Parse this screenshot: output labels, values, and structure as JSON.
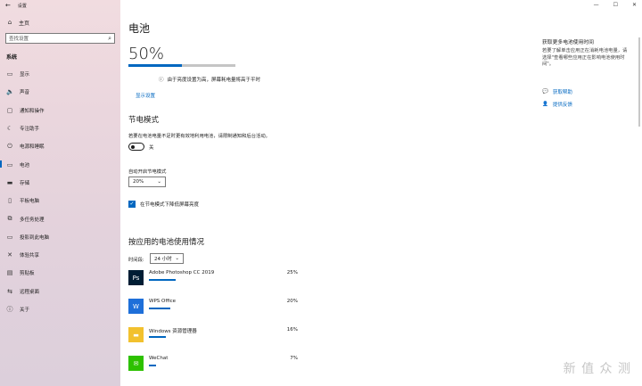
{
  "sidebar": {
    "window_title": "设置",
    "home_label": "主页",
    "search_placeholder": "查找设置",
    "section": "系统",
    "items": [
      {
        "label": "显示",
        "icon": "display-icon"
      },
      {
        "label": "声音",
        "icon": "sound-icon"
      },
      {
        "label": "通知和操作",
        "icon": "notification-icon"
      },
      {
        "label": "专注助手",
        "icon": "focus-assist-icon"
      },
      {
        "label": "电源和睡眠",
        "icon": "power-icon"
      },
      {
        "label": "电池",
        "icon": "battery-icon",
        "active": true
      },
      {
        "label": "存储",
        "icon": "storage-icon"
      },
      {
        "label": "平板电脑",
        "icon": "tablet-icon"
      },
      {
        "label": "多任务处理",
        "icon": "multitasking-icon"
      },
      {
        "label": "投影到此电脑",
        "icon": "projecting-icon"
      },
      {
        "label": "体验共享",
        "icon": "shared-experiences-icon"
      },
      {
        "label": "剪贴板",
        "icon": "clipboard-icon"
      },
      {
        "label": "远程桌面",
        "icon": "remote-desktop-icon"
      },
      {
        "label": "关于",
        "icon": "info-icon"
      }
    ]
  },
  "main": {
    "title": "电池",
    "battery_percent": "50%",
    "battery_level": 0.5,
    "info_text": "由于亮度设置为高，屏幕耗电量将高于平时",
    "show_settings": "显示设置",
    "battery_saver": {
      "heading": "节电模式",
      "description": "若要在电池电量不足时更有效地利用电池，请限制通知和后台活动。",
      "toggle_state": "关",
      "auto_label": "自动开启节电模式",
      "auto_value": "20%",
      "checkbox_label": "在节电模式下降低屏幕亮度"
    },
    "usage": {
      "heading": "按应用的电池使用情况",
      "period_label": "时间段:",
      "period_value": "24 小时",
      "apps": [
        {
          "name": "Adobe Photoshop CC 2019",
          "percent": "25%",
          "share": 0.25,
          "icon_color": "#001d34",
          "icon_text": "Ps"
        },
        {
          "name": "WPS Office",
          "percent": "20%",
          "share": 0.2,
          "icon_color": "#1e6fd9",
          "icon_text": "W"
        },
        {
          "name": "Windows 资源管理器",
          "percent": "16%",
          "share": 0.16,
          "icon_color": "#f2c12e",
          "icon_text": "▬"
        },
        {
          "name": "WeChat",
          "percent": "7%",
          "share": 0.07,
          "icon_color": "#2dc100",
          "icon_text": "✉"
        }
      ]
    }
  },
  "right_panel": {
    "title": "获取更多电池使用时间",
    "text": "若要了解单击应用正在消耗电池电量，请选择\"查看哪些应用正在影响电池使用时间\"。",
    "help_link": "获取帮助",
    "feedback_link": "提供反馈"
  },
  "window": {
    "minimize": "—",
    "maximize": "☐",
    "close": "✕"
  },
  "watermark": "新 值 众 测",
  "colors": {
    "accent": "#0067c0"
  }
}
